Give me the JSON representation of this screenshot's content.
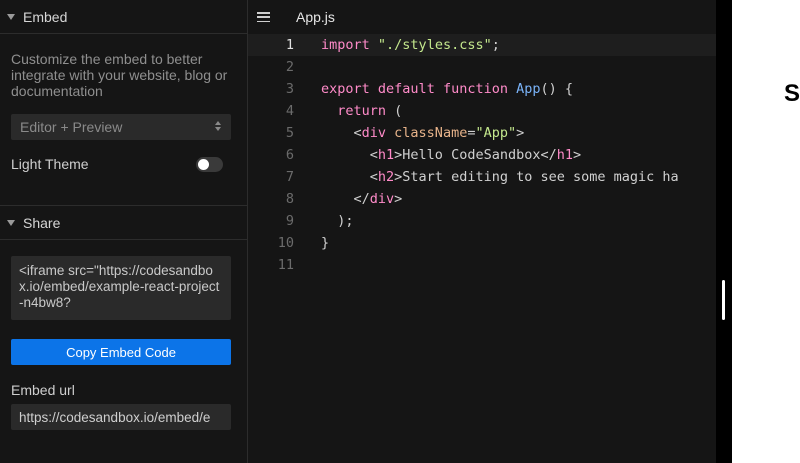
{
  "sidebar": {
    "embed_title": "Embed",
    "description": "Customize the embed to better integrate with your website, blog or documentation",
    "view_select": "Editor + Preview",
    "light_theme_label": "Light Theme",
    "light_theme_on": false,
    "share_title": "Share",
    "embed_code": "<iframe src=\"https://codesandbox.io/embed/example-react-project-n4bw8?",
    "copy_button": "Copy Embed Code",
    "embed_url_label": "Embed url",
    "embed_url_value": "https://codesandbox.io/embed/e"
  },
  "editor": {
    "tab_label": "App.js",
    "active_line": 1,
    "lines": [
      {
        "num": "1",
        "tokens": [
          [
            "kw",
            "import"
          ],
          [
            "punc",
            " "
          ],
          [
            "str",
            "\"./styles.css\""
          ],
          [
            "punc",
            ";"
          ]
        ]
      },
      {
        "num": "2",
        "tokens": []
      },
      {
        "num": "3",
        "tokens": [
          [
            "kw",
            "export"
          ],
          [
            "punc",
            " "
          ],
          [
            "kw",
            "default"
          ],
          [
            "punc",
            " "
          ],
          [
            "kw",
            "function"
          ],
          [
            "punc",
            " "
          ],
          [
            "fn",
            "App"
          ],
          [
            "punc",
            "() {"
          ]
        ]
      },
      {
        "num": "4",
        "tokens": [
          [
            "punc",
            "  "
          ],
          [
            "kw",
            "return"
          ],
          [
            "punc",
            " ("
          ]
        ]
      },
      {
        "num": "5",
        "tokens": [
          [
            "punc",
            "    <"
          ],
          [
            "tag",
            "div"
          ],
          [
            "punc",
            " "
          ],
          [
            "attr",
            "className"
          ],
          [
            "punc",
            "="
          ],
          [
            "str",
            "\"App\""
          ],
          [
            "punc",
            ">"
          ]
        ]
      },
      {
        "num": "6",
        "tokens": [
          [
            "punc",
            "      <"
          ],
          [
            "tag",
            "h1"
          ],
          [
            "punc",
            ">Hello CodeSandbox</"
          ],
          [
            "tag",
            "h1"
          ],
          [
            "punc",
            ">"
          ]
        ]
      },
      {
        "num": "7",
        "tokens": [
          [
            "punc",
            "      <"
          ],
          [
            "tag",
            "h2"
          ],
          [
            "punc",
            ">Start editing to see some magic ha"
          ]
        ]
      },
      {
        "num": "8",
        "tokens": [
          [
            "punc",
            "    </"
          ],
          [
            "tag",
            "div"
          ],
          [
            "punc",
            ">"
          ]
        ]
      },
      {
        "num": "9",
        "tokens": [
          [
            "punc",
            "  );"
          ]
        ]
      },
      {
        "num": "10",
        "tokens": [
          [
            "punc",
            "}"
          ]
        ]
      },
      {
        "num": "11",
        "tokens": []
      }
    ]
  },
  "preview": {
    "visible_text": "S"
  },
  "colors": {
    "accent": "#0c74e8",
    "keyword": "#ff8bc9",
    "string": "#c4e88d",
    "function": "#7ab3f8",
    "attribute": "#e7b38a"
  }
}
